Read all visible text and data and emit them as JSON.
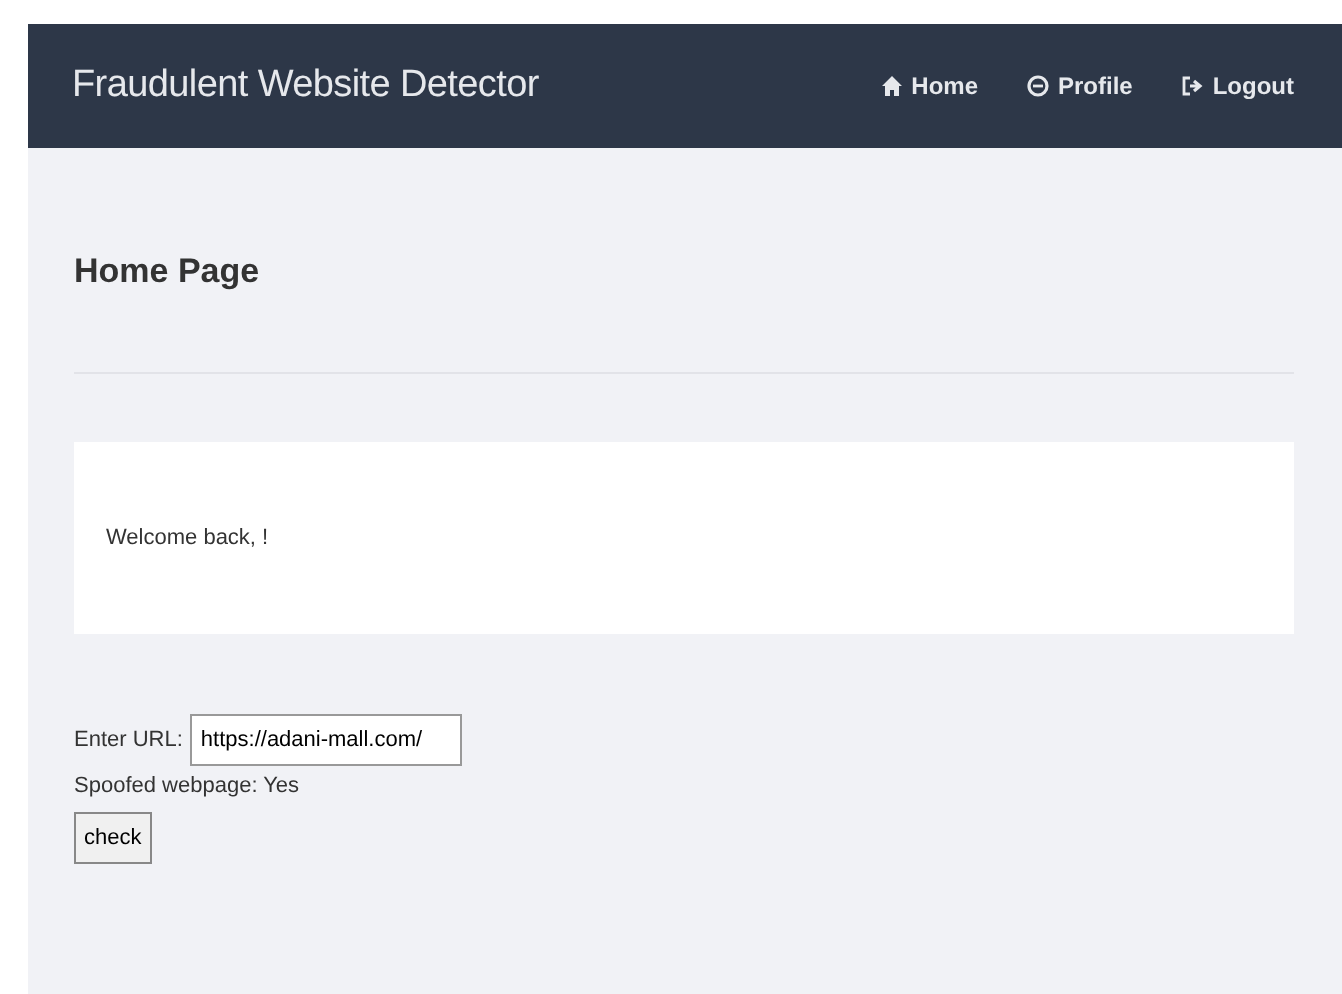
{
  "navbar": {
    "brand": "Fraudulent Website Detector",
    "links": [
      {
        "label": "Home"
      },
      {
        "label": "Profile"
      },
      {
        "label": "Logout"
      }
    ]
  },
  "page_title": "Home Page",
  "welcome": "Welcome back, !",
  "form": {
    "label": "Enter URL:",
    "value": "https://adani-mall.com/",
    "result": "Spoofed webpage: Yes",
    "button": "check"
  }
}
